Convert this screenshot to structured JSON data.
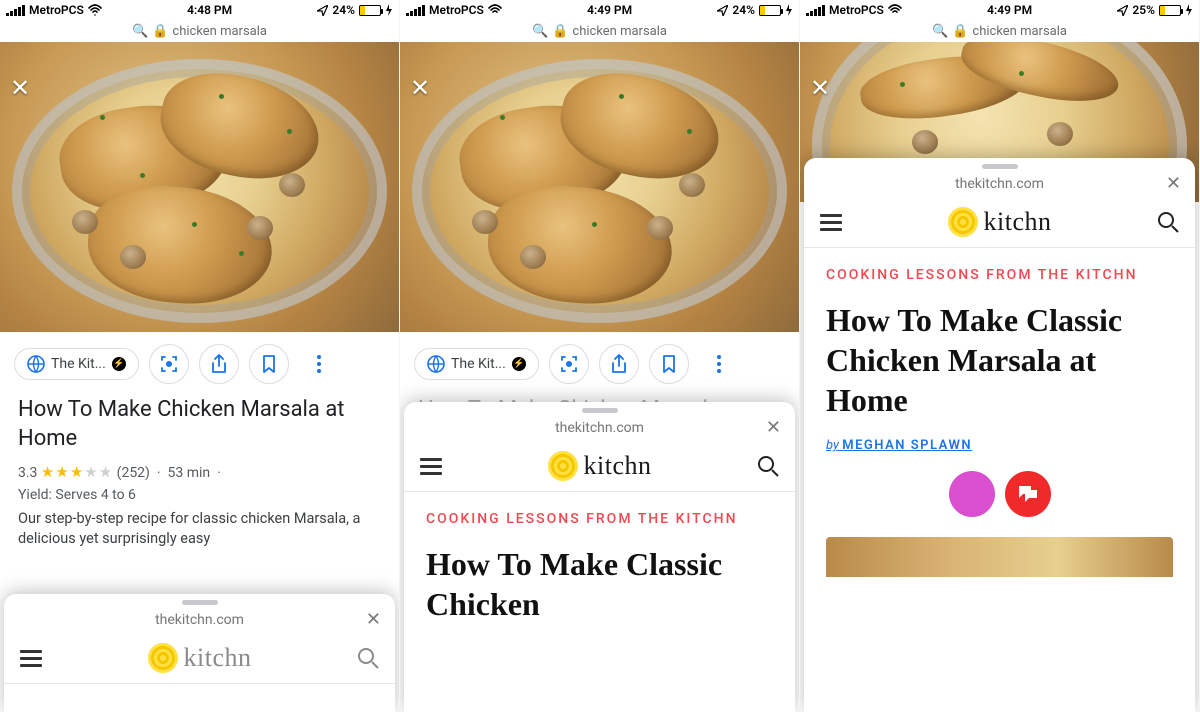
{
  "screens": [
    {
      "status": {
        "carrier": "MetroPCS",
        "time": "4:48 PM",
        "battery_pct": "24%",
        "battery_fill": 24
      },
      "address_bar": "chicken marsala",
      "chip_site": "The Kit...",
      "result_title": "How To Make Chicken Marsala at Home",
      "rating_value": "3.3",
      "rating_count": "(252)",
      "cook_time": "53 min",
      "yield_line": "Yield: Serves 4 to 6",
      "description": "Our step-by-step recipe for classic chicken Marsala, a delicious yet surprisingly easy",
      "sheet_domain": "thekitchn.com",
      "logo_text": "kitchn"
    },
    {
      "status": {
        "carrier": "MetroPCS",
        "time": "4:49 PM",
        "battery_pct": "24%",
        "battery_fill": 24
      },
      "address_bar": "chicken marsala",
      "chip_site": "The Kit...",
      "result_title_ghost": "How To Make Chicken Marsala",
      "sheet_domain": "thekitchn.com",
      "logo_text": "kitchn",
      "kicker": "COOKING LESSONS FROM THE KITCHN",
      "headline_partial": "How To Make Classic Chicken"
    },
    {
      "status": {
        "carrier": "MetroPCS",
        "time": "4:49 PM",
        "battery_pct": "25%",
        "battery_fill": 25
      },
      "address_bar": "chicken marsala",
      "sheet_domain": "thekitchn.com",
      "logo_text": "kitchn",
      "kicker": "COOKING LESSONS FROM THE KITCHN",
      "headline": "How To Make Classic Chicken Marsala at Home",
      "byline_by": "by",
      "byline_name": "MEGHAN SPLAWN"
    }
  ],
  "icons": {
    "search_glyph": "⌕",
    "lock_glyph": "🔒",
    "nav_glyph": "➤",
    "bolt_glyph": "⚡"
  }
}
